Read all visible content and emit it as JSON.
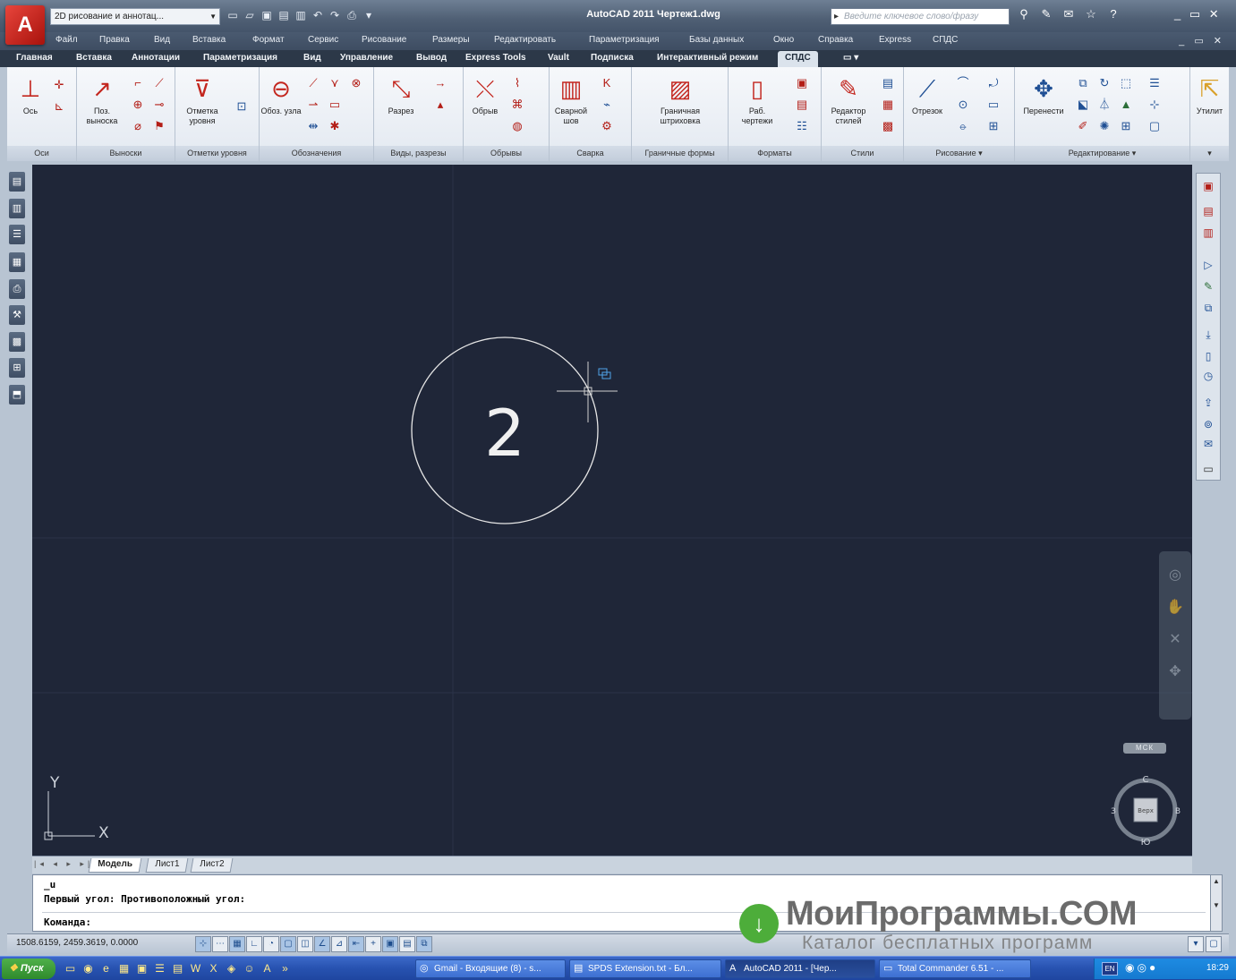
{
  "titlebar": {
    "workspace": "2D рисование и аннотац...",
    "title": "AutoCAD 2011   Чертеж1.dwg",
    "search_placeholder": "Введите ключевое слово/фразу",
    "window_controls": "_ ▭ ✕"
  },
  "menu": {
    "items": [
      "Файл",
      "Правка",
      "Вид",
      "Вставка",
      "Формат",
      "Сервис",
      "Рисование",
      "Размеры",
      "Редактировать",
      "Параметризация",
      "Базы данных",
      "Окно",
      "Справка",
      "Express",
      "СПДС"
    ],
    "mdi_controls": "_ ▭ ✕"
  },
  "tabs": [
    "Главная",
    "Вставка",
    "Аннотации",
    "Параметризация",
    "Вид",
    "Управление",
    "Вывод",
    "Express Tools",
    "Vault",
    "Подписка",
    "Интерактивный режим",
    "СПДС"
  ],
  "active_tab": "СПДС",
  "ribbon": {
    "panels": [
      "Оси",
      "Выноски",
      "Отметки уровня",
      "Обозначения",
      "Виды, разрезы",
      "Обрывы",
      "Сварка",
      "Граничные формы",
      "Форматы",
      "Стили",
      "Рисование ▾",
      "Редактирование ▾"
    ],
    "buttons": {
      "axis": "Ось",
      "pos_leader": "Поз. выноска",
      "level_mark": "Отметка уровня",
      "node_mark": "Обоз. узла",
      "section": "Разрез",
      "break": "Обрыв",
      "weld": "Сварной шов",
      "hatch": "Граничная штриховка",
      "sheet": "Раб. чертежи",
      "style_editor": "Редактор стилей",
      "line": "Отрезок",
      "move": "Перенести",
      "utilities": "Утилит"
    }
  },
  "drawing": {
    "circle_label": "2",
    "ucs": {
      "x": "X",
      "y": "Y"
    },
    "viewcube": {
      "north": "С",
      "south": "Ю",
      "west": "З",
      "east": "В",
      "face": "Верх"
    },
    "mcs_label": "МСК"
  },
  "layout_tabs": {
    "nav": "|◂ ◂ ▸ ▸|",
    "items": [
      "Модель",
      "Лист1",
      "Лист2"
    ],
    "active": "Модель"
  },
  "command": {
    "lines": [
      "_u",
      "Первый угол: Противоположный угол:",
      "Команда:"
    ]
  },
  "status": {
    "coords": "1508.6159, 2459.3619, 0.0000"
  },
  "watermark": {
    "main": "МоиПрограммы.COM",
    "sub": "Каталог бесплатных программ"
  },
  "taskbar": {
    "start": "Пуск",
    "tasks": [
      "Gmail - Входящие (8) - s...",
      "SPDS Extension.txt - Бл...",
      "AutoCAD 2011 - [Чер...",
      "Total Commander 6.51 - ..."
    ],
    "lang": "EN",
    "clock": "18:29"
  },
  "colors": {
    "drawing_bg": "#1f2638",
    "grid": "#2b3349",
    "entity": "#e6e6e6",
    "crosshair": "#d0d0d0",
    "accent_red": "#c3261e"
  }
}
